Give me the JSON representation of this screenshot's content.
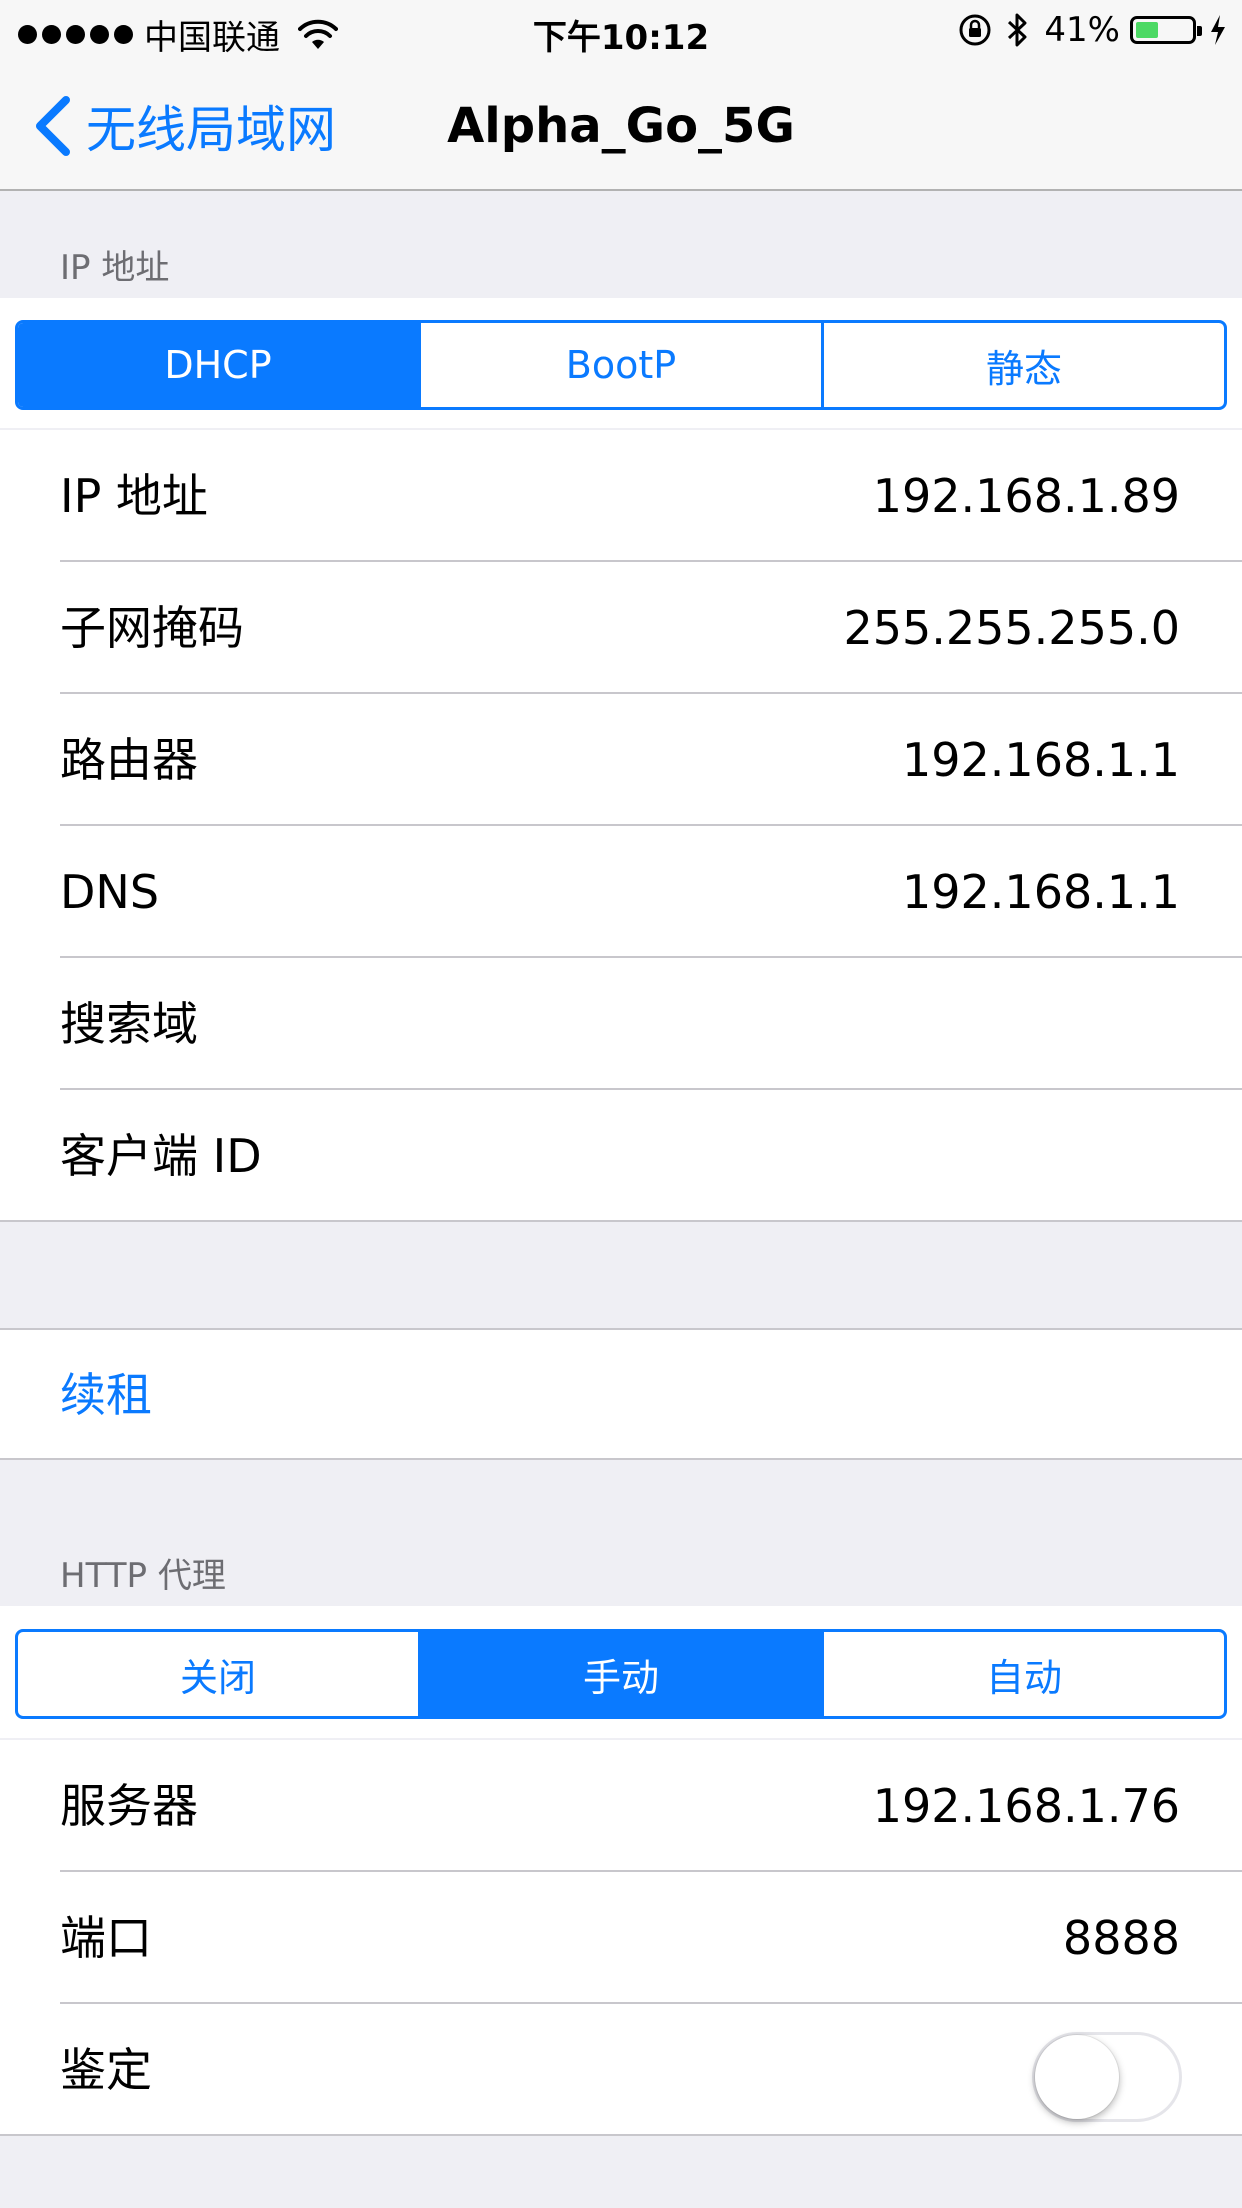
{
  "status_bar": {
    "carrier": "中国联通",
    "time": "下午10:12",
    "battery_percent_label": "41%",
    "battery_level": 0.41,
    "icons": [
      "signal-dots-icon",
      "wifi-icon",
      "rotation-lock-icon",
      "bluetooth-icon",
      "battery-icon",
      "charging-bolt-icon"
    ]
  },
  "nav": {
    "back_label": "无线局域网",
    "title": "Alpha_Go_5G"
  },
  "ip_section": {
    "header": "IP 地址",
    "segments": [
      {
        "label": "DHCP",
        "selected": true
      },
      {
        "label": "BootP",
        "selected": false
      },
      {
        "label": "静态",
        "selected": false
      }
    ],
    "rows": [
      {
        "label": "IP 地址",
        "value": "192.168.1.89"
      },
      {
        "label": "子网掩码",
        "value": "255.255.255.0"
      },
      {
        "label": "路由器",
        "value": "192.168.1.1"
      },
      {
        "label": "DNS",
        "value": "192.168.1.1"
      },
      {
        "label": "搜索域",
        "value": ""
      },
      {
        "label": "客户端 ID",
        "value": ""
      }
    ]
  },
  "renew": {
    "label": "续租"
  },
  "proxy_section": {
    "header": "HTTP 代理",
    "segments": [
      {
        "label": "关闭",
        "selected": false
      },
      {
        "label": "手动",
        "selected": true
      },
      {
        "label": "自动",
        "selected": false
      }
    ],
    "rows": [
      {
        "label": "服务器",
        "value": "192.168.1.76"
      },
      {
        "label": "端口",
        "value": "8888"
      }
    ],
    "auth": {
      "label": "鉴定",
      "enabled": false
    }
  },
  "colors": {
    "accent": "#0a7aff",
    "background": "#efeff4",
    "battery_green": "#4cd964"
  }
}
